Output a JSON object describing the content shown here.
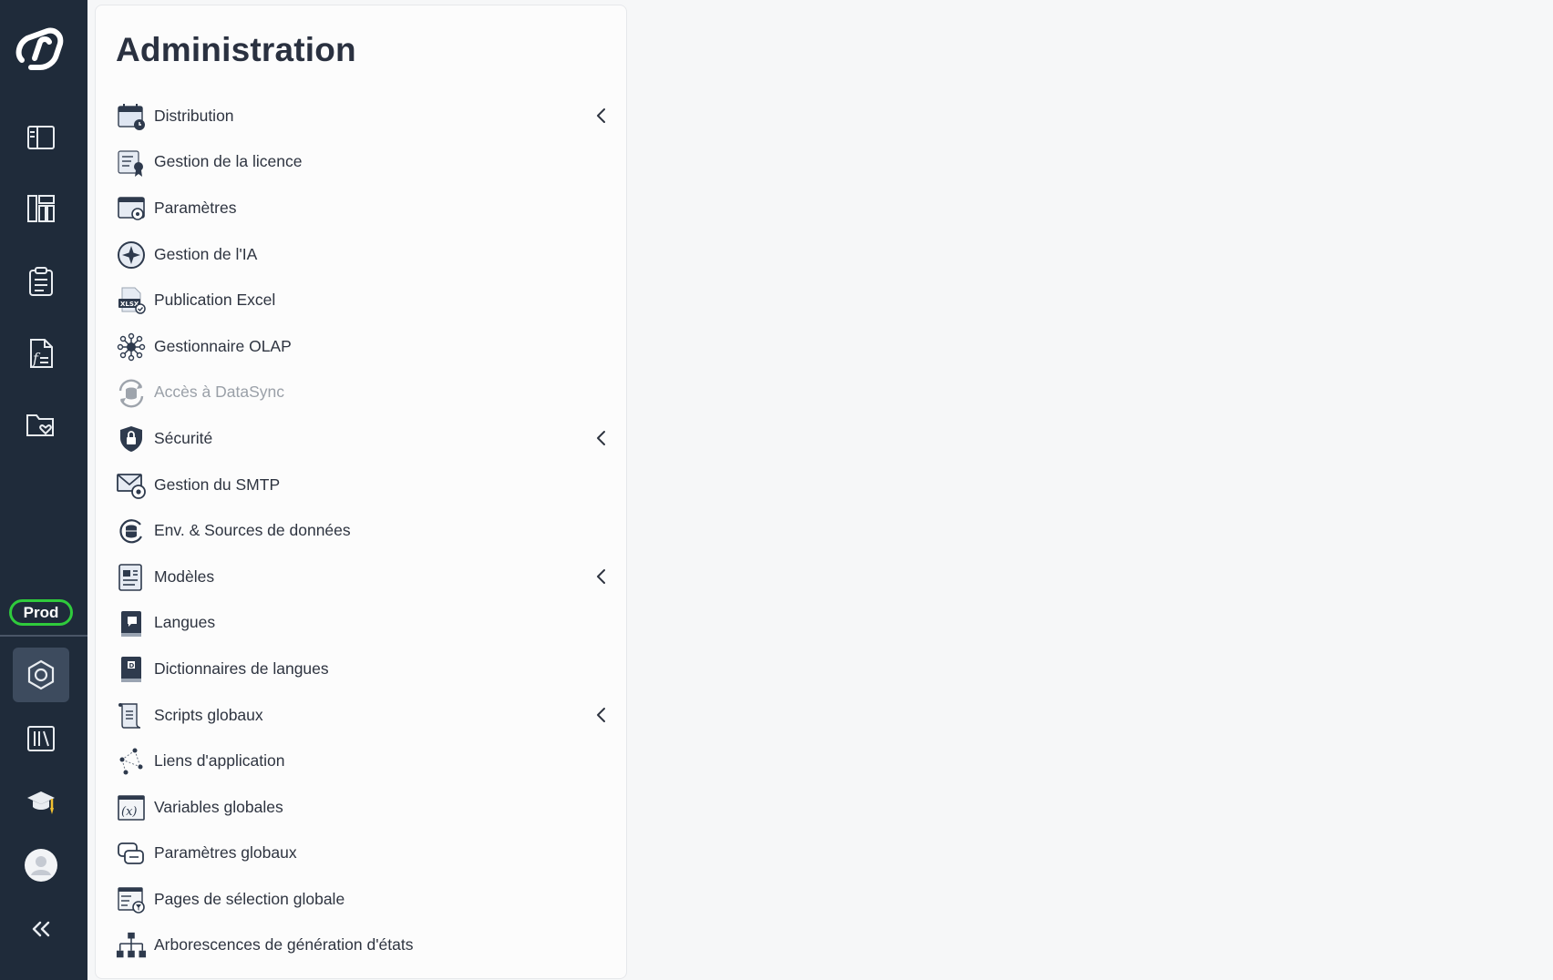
{
  "rail": {
    "logo_icon": "brand-logo-icon",
    "env_badge": "Prod",
    "colors": {
      "background": "#1f2b3a",
      "badge_border": "#2fcb3c"
    }
  },
  "panel": {
    "title": "Administration",
    "items": [
      {
        "label": "Distribution",
        "icon": "calendar-clock-icon",
        "expandable": true
      },
      {
        "label": "Gestion de la licence",
        "icon": "license-certificate-icon",
        "expandable": false
      },
      {
        "label": "Paramètres",
        "icon": "window-gear-icon",
        "expandable": false
      },
      {
        "label": "Gestion de l'IA",
        "icon": "ai-sparkle-icon",
        "expandable": false
      },
      {
        "label": "Publication Excel",
        "icon": "xlsx-file-icon",
        "expandable": false
      },
      {
        "label": "Gestionnaire OLAP",
        "icon": "olap-network-icon",
        "expandable": false
      },
      {
        "label": "Accès à DataSync",
        "icon": "datasync-icon",
        "expandable": false,
        "disabled": true
      },
      {
        "label": "Sécurité",
        "icon": "shield-lock-icon",
        "expandable": true
      },
      {
        "label": "Gestion du SMTP",
        "icon": "mail-gear-icon",
        "expandable": false
      },
      {
        "label": "Env. & Sources de données",
        "icon": "database-sources-icon",
        "expandable": false
      },
      {
        "label": "Modèles",
        "icon": "template-icon",
        "expandable": true
      },
      {
        "label": "Langues",
        "icon": "language-book-icon",
        "expandable": false
      },
      {
        "label": "Dictionnaires de langues",
        "icon": "dictionary-icon",
        "expandable": false
      },
      {
        "label": "Scripts globaux",
        "icon": "script-scroll-icon",
        "expandable": true
      },
      {
        "label": "Liens d'application",
        "icon": "app-links-icon",
        "expandable": false
      },
      {
        "label": "Variables globales",
        "icon": "variable-x-icon",
        "expandable": false
      },
      {
        "label": "Paramètres globaux",
        "icon": "global-params-icon",
        "expandable": false
      },
      {
        "label": "Pages de sélection globale",
        "icon": "selection-page-icon",
        "expandable": false
      },
      {
        "label": "Arborescences de génération d'états",
        "icon": "report-tree-icon",
        "expandable": false
      }
    ]
  }
}
